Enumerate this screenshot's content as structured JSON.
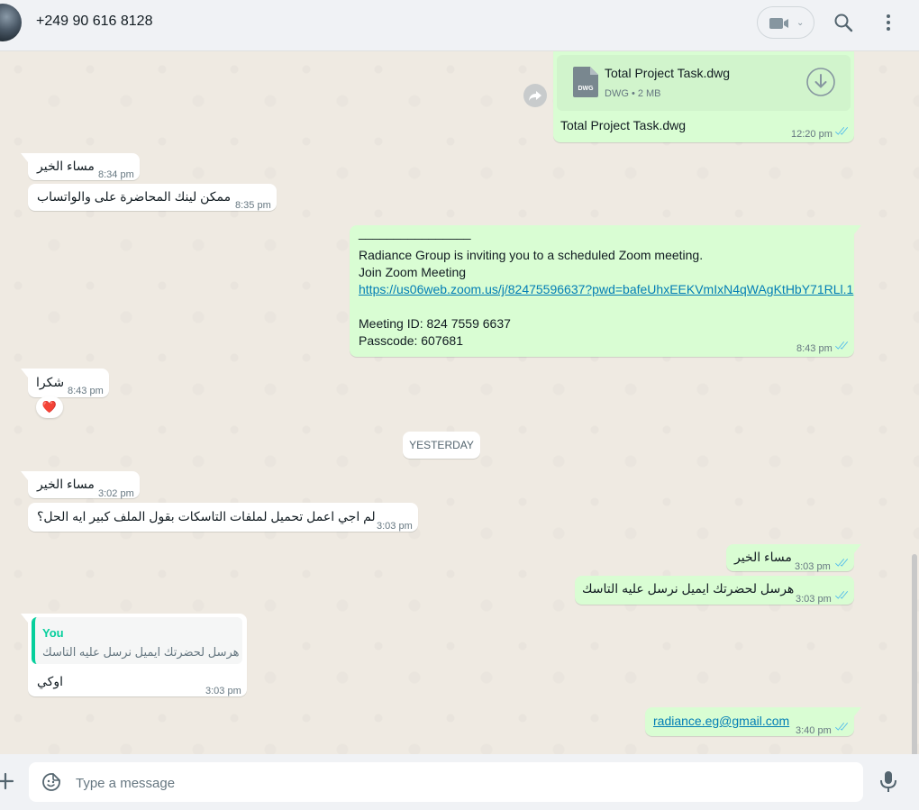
{
  "header": {
    "contact_name": "+249 90 616 8128",
    "icons": [
      "video-camera-icon",
      "chevron-down-icon",
      "search-icon",
      "menu-dots-icon"
    ]
  },
  "messages": {
    "file": {
      "file_name": "Total Project Task.dwg",
      "file_badge": "DWG",
      "file_meta": "DWG • 2 MB",
      "caption": "Total Project Task.dwg",
      "time": "12:20 pm"
    },
    "m1": {
      "text": "مساء الخير",
      "time": "8:34 pm"
    },
    "m2": {
      "text": "ممكن لينك المحاضرة على والواتساب",
      "time": "8:35 pm"
    },
    "zoom": {
      "rule": "________________",
      "line1": "Radiance Group is inviting you to a scheduled Zoom meeting.",
      "line2": "Join Zoom Meeting",
      "link": "https://us06web.zoom.us/j/82475596637?pwd=bafeUhxEEKVmIxN4qWAgKtHbY71RLl.1",
      "meeting_id": "Meeting ID: 824 7559 6637",
      "passcode": "Passcode: 607681",
      "time": "8:43 pm"
    },
    "m3": {
      "text": "شكرا",
      "time": "8:43 pm",
      "reaction": "❤️"
    },
    "day_divider": "YESTERDAY",
    "m4": {
      "text": "مساء الخير",
      "time": "3:02 pm"
    },
    "m5": {
      "text": "لم اجي اعمل تحميل لملفات التاسكات بقول الملف كبير ايه الحل؟",
      "time": "3:03 pm"
    },
    "m6": {
      "text": "مساء الخير",
      "time": "3:03 pm"
    },
    "m7": {
      "text": "هرسل لحضرتك ايميل نرسل عليه التاسك",
      "time": "3:03 pm"
    },
    "m8": {
      "quote_author": "You",
      "quote_text": "هرسل لحضرتك ايميل نرسل عليه التاسك",
      "text": "اوكي",
      "time": "3:03 pm"
    },
    "m9": {
      "text": "radiance.eg@gmail.com",
      "time": "3:40 pm"
    }
  },
  "footer": {
    "placeholder": "Type a message",
    "icons": [
      "plus-icon",
      "sticker-icon",
      "microphone-icon"
    ]
  },
  "colors": {
    "chat_bg": "#efeae2",
    "incoming": "#ffffff",
    "outgoing": "#d9fdd3",
    "read_ticks": "#53bdeb",
    "quote_accent": "#06cf9c",
    "link": "#027eb5"
  }
}
